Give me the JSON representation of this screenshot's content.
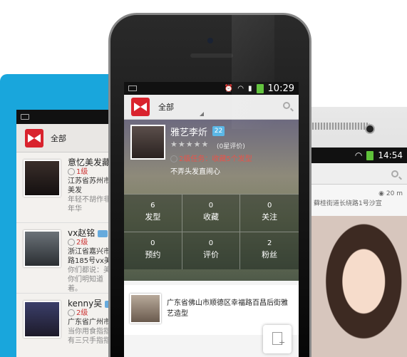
{
  "left_phone": {
    "app_title": "全部",
    "items": [
      {
        "name": "意忆美发藏",
        "level": "1级",
        "address": "江苏省苏州市",
        "address2": "美发",
        "signature": "年轻不胡作非",
        "signature2": "年华"
      },
      {
        "name": "vx赵铭",
        "level": "2级",
        "address": "浙江省嘉兴市",
        "address2": "路185号vx美发",
        "signature": "你们都说：美",
        "signature2": "你们明知道",
        "signature3": "着。"
      },
      {
        "name": "kenny吴",
        "level": "2级",
        "address": "广东省广州市",
        "address2": "",
        "signature": "当你用食指指",
        "signature2": "有三只手指指"
      }
    ]
  },
  "center_phone": {
    "status_time": "10:29",
    "app_title": "全部",
    "profile": {
      "name": "雅艺李炘",
      "level_badge": "22",
      "stars": "★★★★★",
      "rating_text": "(0星评价)",
      "task_text": "2级任务：收藏5个发型",
      "motto": "不弄头发直闹心"
    },
    "stats": [
      {
        "value": "6",
        "label": "发型"
      },
      {
        "value": "0",
        "label": "收藏"
      },
      {
        "value": "0",
        "label": "关注"
      },
      {
        "value": "0",
        "label": "预约"
      },
      {
        "value": "0",
        "label": "评价"
      },
      {
        "value": "2",
        "label": "粉丝"
      }
    ],
    "salon": {
      "address": "广东省佛山市顺德区幸福路百昌后街雅艺造型"
    }
  },
  "right_phone": {
    "status_time": "14:54",
    "distance": "20 m",
    "address_snippet": "藓桂街道长绕路1号沙宣"
  },
  "colors": {
    "brand_red": "#d9232d",
    "left_phone_body": "#19a6dc",
    "level_badge": "#5bb7e6",
    "task_red": "#e9534a"
  }
}
